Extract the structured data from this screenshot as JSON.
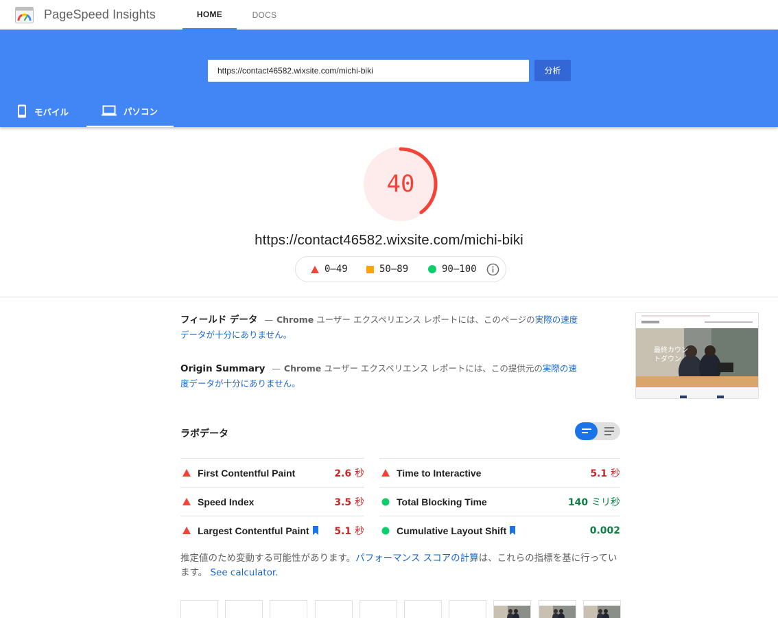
{
  "app": {
    "title": "PageSpeed Insights",
    "logo_icon": "pagespeed-gauge-icon"
  },
  "nav": {
    "tabs": [
      {
        "label": "HOME",
        "active": true
      },
      {
        "label": "DOCS",
        "active": false
      }
    ]
  },
  "search": {
    "value": "https://contact46582.wixsite.com/michi-biki",
    "button_label": "分析"
  },
  "devices": {
    "tabs": [
      {
        "label": "モバイル",
        "icon": "smartphone-icon",
        "active": false
      },
      {
        "label": "パソコン",
        "icon": "laptop-icon",
        "active": true
      }
    ]
  },
  "score": {
    "value": "40",
    "fraction": 0.4,
    "color": "#f44336"
  },
  "page_url": "https://contact46582.wixsite.com/michi-biki",
  "legend": {
    "fail": "0–49",
    "average": "50–89",
    "pass": "90–100",
    "info_icon": "info-icon"
  },
  "field": {
    "heading": "フィールド データ",
    "dash": "—",
    "chrome": "Chrome",
    "text_before": " ユーザー エクスペリエンス レポートには、このページの",
    "link": "実際の速度データが十分にありません。"
  },
  "origin": {
    "heading": "Origin Summary",
    "dash": "—",
    "chrome": "Chrome",
    "text_before": " ユーザー エクスペリエンス レポートには、この提供元の",
    "link": "実際の速度データが十分にありません。"
  },
  "thumbnail": {
    "headline": "最終カウン\nトダウン"
  },
  "lab": {
    "title": "ラボデータ",
    "left": [
      {
        "name": "First Contentful Paint",
        "value": "2.6",
        "unit": "秒",
        "status": "fail",
        "bookmark": false
      },
      {
        "name": "Speed Index",
        "value": "3.5",
        "unit": "秒",
        "status": "fail",
        "bookmark": false
      },
      {
        "name": "Largest Contentful Paint",
        "value": "5.1",
        "unit": "秒",
        "status": "fail",
        "bookmark": true
      }
    ],
    "right": [
      {
        "name": "Time to Interactive",
        "value": "5.1",
        "unit": "秒",
        "status": "fail",
        "bookmark": false
      },
      {
        "name": "Total Blocking Time",
        "value": "140",
        "unit": "ミリ秒",
        "status": "pass",
        "bookmark": false
      },
      {
        "name": "Cumulative Layout Shift",
        "value": "0.002",
        "unit": "",
        "status": "pass",
        "bookmark": true
      }
    ]
  },
  "note": {
    "text_before": "推定値のため変動する可能性があります。",
    "link": "パフォーマンス スコアの計算",
    "text_after": "は、これらの指標を基に行っています。",
    "calculator": "See calculator."
  },
  "colors": {
    "brand_blue": "#4285f4",
    "fail": "#f44336",
    "average": "#ffa400",
    "pass": "#0cce6b"
  }
}
